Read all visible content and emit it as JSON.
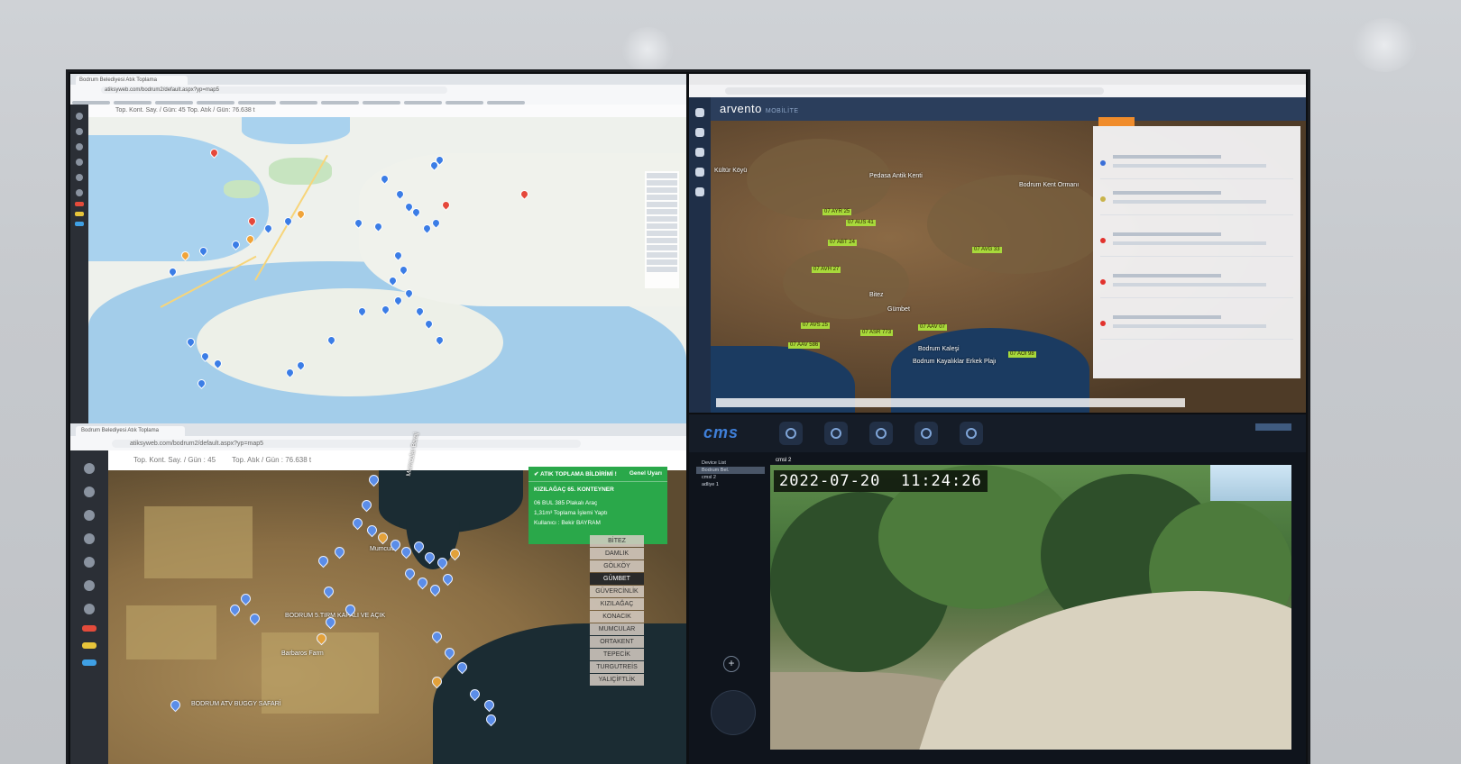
{
  "map_street": {
    "tab_title": "Bodrum Belediyesi Atık Toplama",
    "url": "atiksyweb.com/bodrum2/default.aspx?yp=map5",
    "stats": "Top. Kont. Say. / Gün: 45     Top. Atık / Gün: 76.638 t"
  },
  "arvento": {
    "logo": "arvento",
    "logo_sub": "MOBİLİTE",
    "places": [
      "Pedasa Antik Kenti",
      "Bodrum Kent Ormanı",
      "Kültür Köyü",
      "Bitez",
      "Gümbet",
      "Bodrum Kaleşi",
      "Bodrum Kayalıklar Erkek Plajı"
    ],
    "vehicles": [
      "07 AYR 25",
      "07 AUS 41",
      "07 ABT 24",
      "07 AVH 27",
      "07 AVG 33",
      "07 AVS 25",
      "07 AAV 586",
      "07 ASR 773",
      "07 AAV 07",
      "07 AOI 98"
    ]
  },
  "satellite": {
    "tab_title": "Bodrum Belediyesi Atık Toplama",
    "url": "atiksyweb.com/bodrum2/default.aspx?yp=map5",
    "stat_containers": "Top. Kont. Say. / Gün : 45",
    "stat_waste": "Top. Atık / Gün : 76.638 t",
    "places": [
      "BODRUM 5.TIRM KAPALI VE AÇIK",
      "Barbaros Farm",
      "BODRUM ATV BUGGY SAFARİ",
      "Mumcular",
      "Mumcular Baraj"
    ],
    "notification": {
      "title": "ATIK TOPLAMA BİLDİRİMİ !",
      "action": "Genel Uyarı",
      "container": "KIZILAĞAÇ 65. KONTEYNER",
      "vehicle": "06 BUL 385 Plakalı Araç",
      "volume": "1,31m³ Toplama İşlemi Yaptı",
      "user": "Kullanıcı : Bekir BAYRAM"
    },
    "districts": [
      "BİTEZ",
      "DAMLIK",
      "GÖLKÖY",
      "GÜMBET",
      "GÜVERCİNLİK",
      "KIZILAĞAÇ",
      "KONACIK",
      "MUMCULAR",
      "ORTAKENT",
      "TEPECİK",
      "TURGUTREİS",
      "YALIÇİFTLİK"
    ],
    "selected_district": "GÜMBET"
  },
  "cms": {
    "logo": "cms",
    "tree": [
      "Device List",
      "Bodrum Bel.",
      "cmsl 2",
      "adliye 1"
    ],
    "camera_label": "cmsl 2",
    "osd_date": "2022-07-20",
    "osd_time": "11:24:26",
    "plus": "+"
  }
}
